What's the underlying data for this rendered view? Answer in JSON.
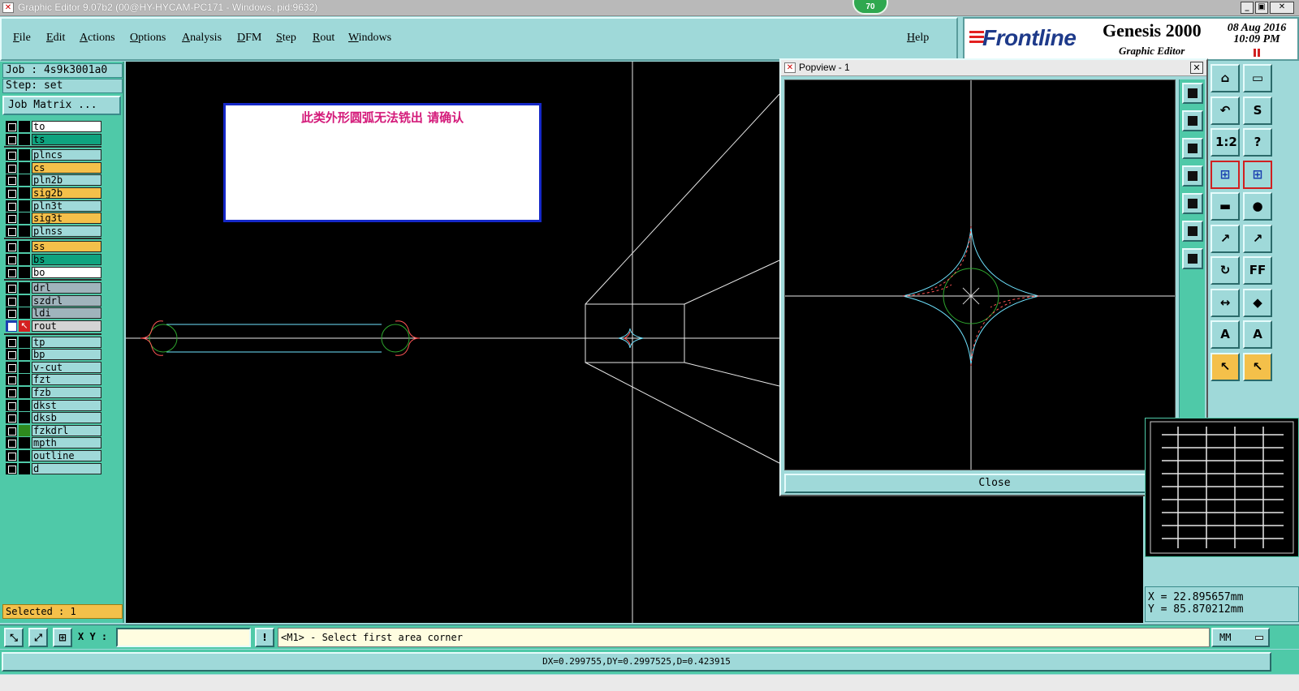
{
  "window": {
    "title": "Graphic Editor 9.07b2 (00@HY-HYCAM-PC171 - Windows, pid:9632)",
    "badge": "70",
    "minimize": "_",
    "restore": "▣",
    "close": "✕"
  },
  "menu": {
    "items": [
      "File",
      "Edit",
      "Actions",
      "Options",
      "Analysis",
      "DFM",
      "Step",
      "Rout",
      "Windows"
    ],
    "help": "Help"
  },
  "brand": {
    "company": "Frontline",
    "product": "Genesis 2000",
    "subtitle": "Graphic Editor",
    "date": "08 Aug 2016",
    "time": "10:09 PM"
  },
  "left_panel": {
    "job": "Job : 4s9k3001a0",
    "step": "Step: set",
    "job_matrix_button": "Job Matrix ...",
    "selected": "Selected : 1",
    "layers": [
      {
        "name": "to",
        "color": "#ffffff",
        "marker": "none",
        "active": false,
        "group": 0
      },
      {
        "name": "ts",
        "color": "#0fa37f",
        "marker": "none",
        "active": false,
        "group": 0
      },
      {
        "name": "plncs",
        "color": "#9fd9d9",
        "marker": "none",
        "active": false,
        "group": 1
      },
      {
        "name": "cs",
        "color": "#f4c04a",
        "marker": "none",
        "active": false,
        "group": 1
      },
      {
        "name": "pln2b",
        "color": "#9fd9d9",
        "marker": "none",
        "active": false,
        "group": 1
      },
      {
        "name": "sig2b",
        "color": "#f4c04a",
        "marker": "none",
        "active": false,
        "group": 1
      },
      {
        "name": "pln3t",
        "color": "#9fd9d9",
        "marker": "none",
        "active": false,
        "group": 1
      },
      {
        "name": "sig3t",
        "color": "#f4c04a",
        "marker": "none",
        "active": false,
        "group": 1
      },
      {
        "name": "plnss",
        "color": "#9fd9d9",
        "marker": "none",
        "active": false,
        "group": 1
      },
      {
        "name": "ss",
        "color": "#f4c04a",
        "marker": "none",
        "active": false,
        "group": 2
      },
      {
        "name": "bs",
        "color": "#0fa37f",
        "marker": "none",
        "active": false,
        "group": 2
      },
      {
        "name": "bo",
        "color": "#ffffff",
        "marker": "none",
        "active": false,
        "group": 2
      },
      {
        "name": "drl",
        "color": "#a0b4bc",
        "marker": "none",
        "active": false,
        "group": 3
      },
      {
        "name": "szdrl",
        "color": "#a0b4bc",
        "marker": "none",
        "active": false,
        "group": 3
      },
      {
        "name": "ldi",
        "color": "#a0b4bc",
        "marker": "none",
        "active": false,
        "group": 3
      },
      {
        "name": "rout",
        "color": "#d4d4d4",
        "marker": "arrow",
        "active": true,
        "group": 3
      },
      {
        "name": "tp",
        "color": "#9fd9d9",
        "marker": "none",
        "active": false,
        "group": 4
      },
      {
        "name": "bp",
        "color": "#9fd9d9",
        "marker": "none",
        "active": false,
        "group": 4
      },
      {
        "name": "v-cut",
        "color": "#9fd9d9",
        "marker": "none",
        "active": false,
        "group": 4
      },
      {
        "name": "fzt",
        "color": "#9fd9d9",
        "marker": "none",
        "active": false,
        "group": 4
      },
      {
        "name": "fzb",
        "color": "#9fd9d9",
        "marker": "none",
        "active": false,
        "group": 4
      },
      {
        "name": "dkst",
        "color": "#9fd9d9",
        "marker": "none",
        "active": false,
        "group": 4
      },
      {
        "name": "dksb",
        "color": "#9fd9d9",
        "marker": "none",
        "active": false,
        "group": 4
      },
      {
        "name": "fzkdrl",
        "color": "#9fd9d9",
        "marker": "green",
        "active": false,
        "group": 4
      },
      {
        "name": "mpth",
        "color": "#9fd9d9",
        "marker": "none",
        "active": false,
        "group": 4
      },
      {
        "name": "outline",
        "color": "#9fd9d9",
        "marker": "none",
        "active": false,
        "group": 4
      },
      {
        "name": "d",
        "color": "#9fd9d9",
        "marker": "none",
        "active": false,
        "group": 4
      }
    ]
  },
  "canvas": {
    "message": "此类外形圆弧无法铣出 请确认"
  },
  "popview": {
    "title": "Popview - 1",
    "close_button": "Close"
  },
  "coords": {
    "x": "X = 22.895657mm",
    "y": "Y = 85.870212mm"
  },
  "bottom": {
    "xy_label": "X Y :",
    "xy_value": "",
    "prompt_button": "!",
    "prompt": "<M1> - Select first area corner",
    "units": "MM",
    "status": "DX=0.299755,DY=0.2997525,D=0.423915"
  },
  "right_tools": [
    {
      "name": "home-icon",
      "glyph": "⌂",
      "style": "normal"
    },
    {
      "name": "window-icon",
      "glyph": "▭",
      "style": "normal"
    },
    {
      "name": "undo-icon",
      "glyph": "↶",
      "style": "normal"
    },
    {
      "name": "snap-icon",
      "glyph": "S",
      "style": "normal"
    },
    {
      "name": "scale-icon",
      "glyph": "1:2",
      "style": "normal"
    },
    {
      "name": "help-icon",
      "glyph": "?",
      "style": "normal"
    },
    {
      "name": "route-net-icon",
      "glyph": "⊞",
      "style": "red"
    },
    {
      "name": "route-net-alt-icon",
      "glyph": "⊞",
      "style": "red"
    },
    {
      "name": "ruler-icon",
      "glyph": "▬",
      "style": "normal"
    },
    {
      "name": "pad-icon",
      "glyph": "●",
      "style": "normal"
    },
    {
      "name": "move-point-icon",
      "glyph": "↗",
      "style": "normal"
    },
    {
      "name": "move-point-alt-icon",
      "glyph": "↗",
      "style": "normal"
    },
    {
      "name": "rotate-icon",
      "glyph": "↻",
      "style": "normal"
    },
    {
      "name": "mirror-icon",
      "glyph": "FF",
      "style": "normal"
    },
    {
      "name": "measure-icon",
      "glyph": "↔",
      "style": "normal"
    },
    {
      "name": "shapes-icon",
      "glyph": "◆",
      "style": "normal"
    },
    {
      "name": "arch-icon",
      "glyph": "A",
      "style": "normal"
    },
    {
      "name": "arch-alt-icon",
      "glyph": "A",
      "style": "normal"
    },
    {
      "name": "select-icon",
      "glyph": "↖",
      "style": "yellow"
    },
    {
      "name": "select-net-icon",
      "glyph": "↖",
      "style": "yellow"
    }
  ]
}
